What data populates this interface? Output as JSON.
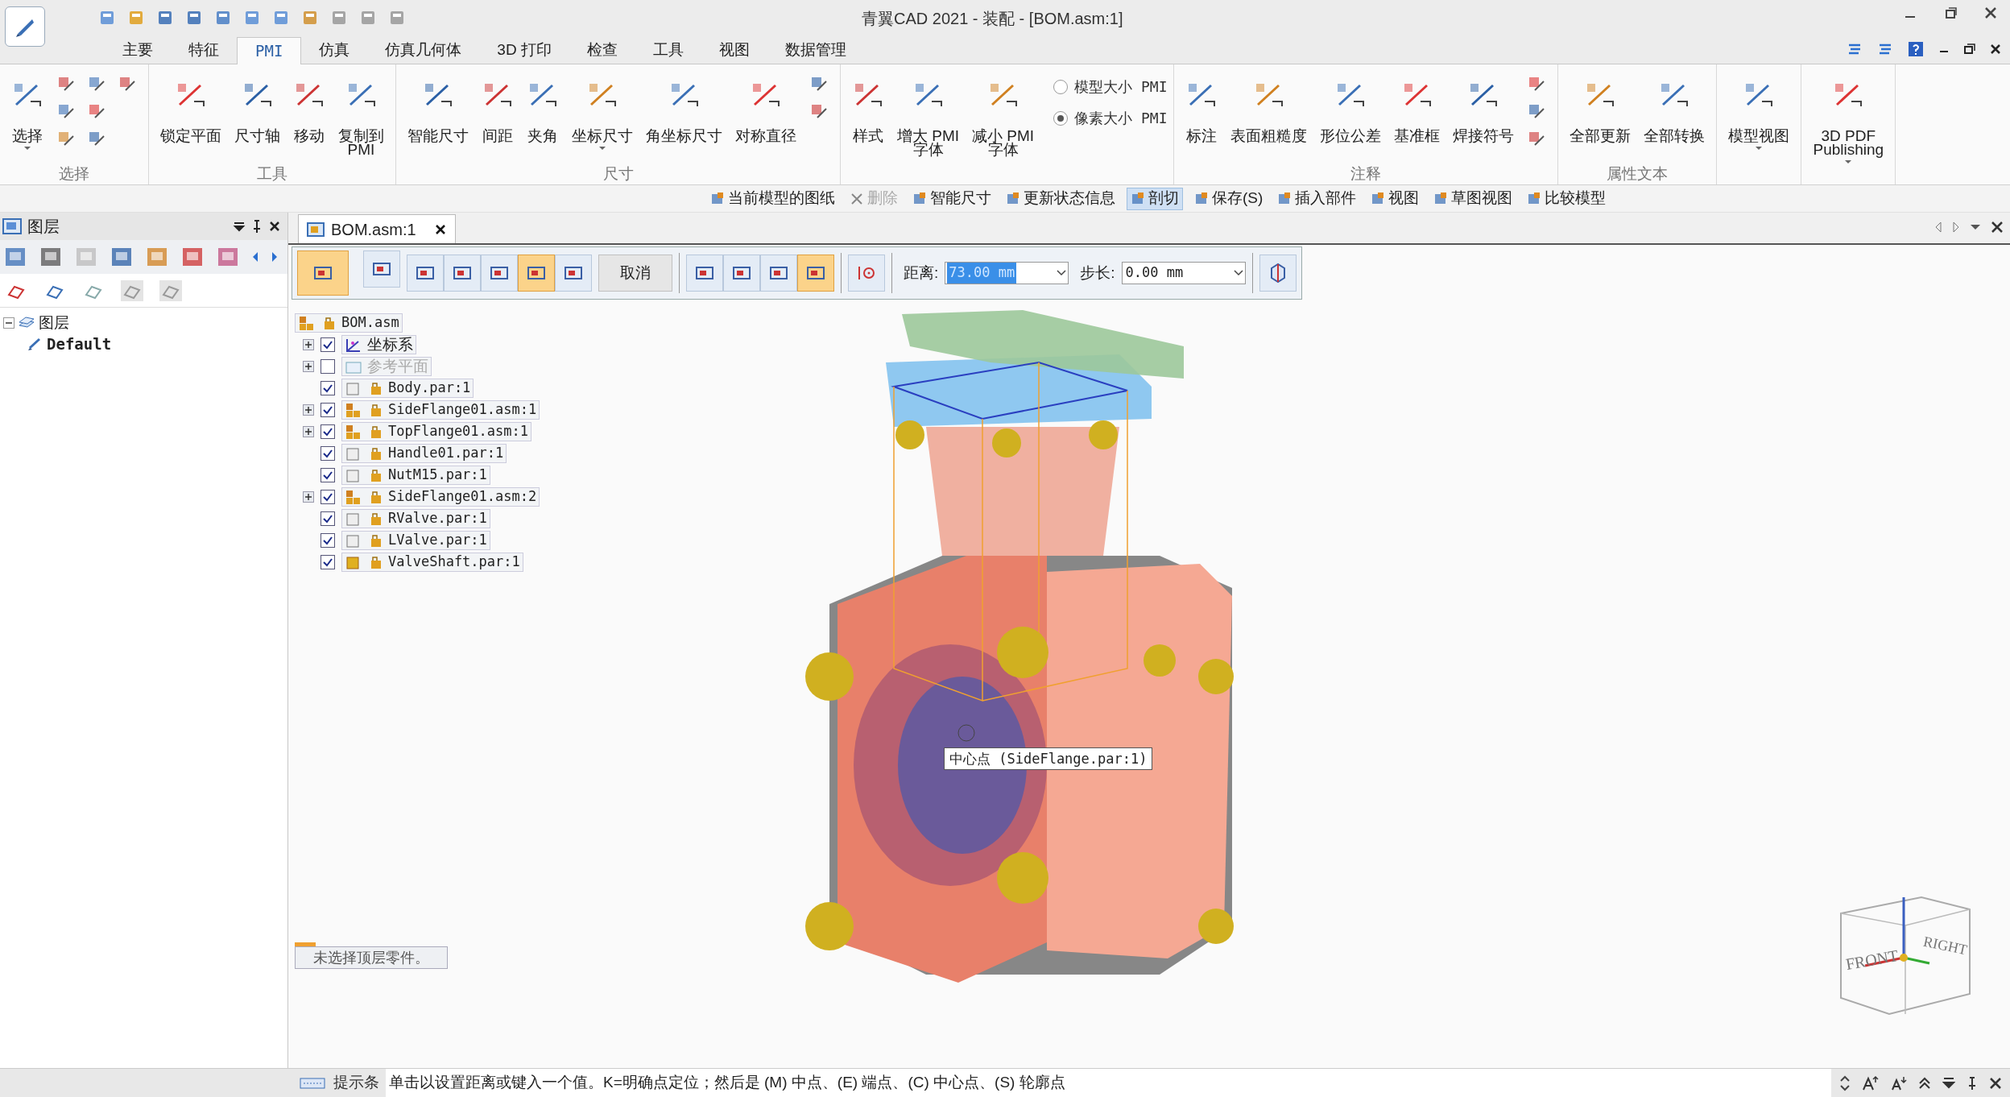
{
  "window": {
    "title": "青翼CAD 2021 - 装配 - [BOM.asm:1]"
  },
  "ribbon_tabs": [
    {
      "label": "主要",
      "selected": false
    },
    {
      "label": "特征",
      "selected": false
    },
    {
      "label": "PMI",
      "selected": true
    },
    {
      "label": "仿真",
      "selected": false
    },
    {
      "label": "仿真几何体",
      "selected": false
    },
    {
      "label": "3D 打印",
      "selected": false
    },
    {
      "label": "检查",
      "selected": false
    },
    {
      "label": "工具",
      "selected": false
    },
    {
      "label": "视图",
      "selected": false
    },
    {
      "label": "数据管理",
      "selected": false
    }
  ],
  "ribbon_groups": [
    {
      "label": "选择",
      "items": [
        {
          "kind": "large",
          "label": "选择",
          "dropdown": true
        },
        {
          "kind": "small"
        },
        {
          "kind": "small"
        },
        {
          "kind": "small"
        },
        {
          "kind": "small"
        },
        {
          "kind": "small"
        },
        {
          "kind": "small"
        },
        {
          "kind": "small"
        }
      ]
    },
    {
      "label": "工具",
      "items": [
        {
          "kind": "large",
          "label": "锁定平面"
        },
        {
          "kind": "large",
          "label": "尺寸轴"
        },
        {
          "kind": "large",
          "label": "移动"
        },
        {
          "kind": "large",
          "label": "复制到\nPMI"
        }
      ]
    },
    {
      "label": "尺寸",
      "items": [
        {
          "kind": "large",
          "label": "智能尺寸"
        },
        {
          "kind": "large",
          "label": "间距"
        },
        {
          "kind": "large",
          "label": "夹角"
        },
        {
          "kind": "large",
          "label": "坐标尺寸",
          "dropdown": true
        },
        {
          "kind": "large",
          "label": "角坐标尺寸"
        },
        {
          "kind": "large",
          "label": "对称直径"
        },
        {
          "kind": "small"
        },
        {
          "kind": "small"
        }
      ]
    },
    {
      "items": [
        {
          "kind": "large",
          "label": "样式"
        },
        {
          "kind": "large",
          "label": "增大 PMI\n字体"
        },
        {
          "kind": "large",
          "label": "减小 PMI\n字体"
        },
        {
          "kind": "radio",
          "label": "模型大小 PMI",
          "selected": false
        },
        {
          "kind": "radio",
          "label": "像素大小 PMI",
          "selected": true
        }
      ]
    },
    {
      "label": "注释",
      "items": [
        {
          "kind": "large",
          "label": "标注"
        },
        {
          "kind": "large",
          "label": "表面粗糙度"
        },
        {
          "kind": "large",
          "label": "形位公差"
        },
        {
          "kind": "large",
          "label": "基准框"
        },
        {
          "kind": "large",
          "label": "焊接符号"
        },
        {
          "kind": "small"
        },
        {
          "kind": "small"
        },
        {
          "kind": "small"
        }
      ]
    },
    {
      "label": "属性文本",
      "items": [
        {
          "kind": "large",
          "label": "全部更新"
        },
        {
          "kind": "large",
          "label": "全部转换"
        }
      ]
    },
    {
      "items": [
        {
          "kind": "large",
          "label": "模型视图",
          "dropdown": true
        }
      ]
    },
    {
      "items": [
        {
          "kind": "large",
          "label": "3D PDF\nPublishing",
          "dropdown": true
        }
      ]
    }
  ],
  "command_bar": [
    {
      "label": "当前模型的图纸",
      "disabled": false,
      "selected": false
    },
    {
      "label": "删除",
      "disabled": true,
      "selected": false
    },
    {
      "label": "智能尺寸",
      "disabled": false,
      "selected": false
    },
    {
      "label": "更新状态信息",
      "disabled": false,
      "selected": false
    },
    {
      "label": "剖切",
      "disabled": false,
      "selected": true
    },
    {
      "label": "保存(S)",
      "disabled": false,
      "selected": false
    },
    {
      "label": "插入部件",
      "disabled": false,
      "selected": false
    },
    {
      "label": "视图",
      "disabled": false,
      "selected": false
    },
    {
      "label": "草图视图",
      "disabled": false,
      "selected": false
    },
    {
      "label": "比较模型",
      "disabled": false,
      "selected": false
    }
  ],
  "left_panel": {
    "title": "图层",
    "tree": [
      {
        "label": "图层",
        "expanded": true,
        "children": [
          {
            "label": "Default"
          }
        ]
      }
    ]
  },
  "document_tab": {
    "label": "BOM.asm:1"
  },
  "cut_toolbar": {
    "toggles_a": [
      {
        "selected": true
      },
      {
        "selected": false
      }
    ],
    "toggles_b": [
      {
        "selected": false
      },
      {
        "selected": false
      },
      {
        "selected": false
      },
      {
        "selected": true
      },
      {
        "selected": false
      }
    ],
    "cancel": "取消",
    "toggles_c": [
      {
        "selected": false
      },
      {
        "selected": false
      },
      {
        "selected": false
      },
      {
        "selected": true
      }
    ],
    "distance_label": "距离:",
    "distance_value": "73.00 mm",
    "step_label": "步长:",
    "step_value": "0.00 mm"
  },
  "assembly_tree": {
    "root": "BOM.asm",
    "items": [
      {
        "label": "坐标系",
        "kind": "coordinate",
        "checked": true,
        "expander": true
      },
      {
        "label": "参考平面",
        "kind": "plane",
        "checked": false,
        "expander": true
      },
      {
        "label": "Body.par:1",
        "kind": "part",
        "checked": true,
        "expander": false
      },
      {
        "label": "SideFlange01.asm:1",
        "kind": "assembly",
        "checked": true,
        "expander": true
      },
      {
        "label": "TopFlange01.asm:1",
        "kind": "assembly",
        "checked": true,
        "expander": true
      },
      {
        "label": "Handle01.par:1",
        "kind": "part",
        "checked": true,
        "expander": false
      },
      {
        "label": "NutM15.par:1",
        "kind": "part",
        "checked": true,
        "expander": false
      },
      {
        "label": "SideFlange01.asm:2",
        "kind": "assembly",
        "checked": true,
        "expander": true
      },
      {
        "label": "RValve.par:1",
        "kind": "part",
        "checked": true,
        "expander": false
      },
      {
        "label": "LValve.par:1",
        "kind": "part",
        "checked": true,
        "expander": false
      },
      {
        "label": "ValveShaft.par:1",
        "kind": "solid",
        "checked": true,
        "expander": false
      }
    ]
  },
  "tooltip": "中心点 (SideFlange.par:1)",
  "selection_message": "未选择顶层零件。",
  "view_cube": {
    "front": "FRONT",
    "right": "RIGHT"
  },
  "status_bar": {
    "label": "提示条",
    "message": "单击以设置距离或键入一个值。K=明确点定位；然后是 (M) 中点、(E) 端点、(C) 中心点、(S) 轮廓点"
  }
}
